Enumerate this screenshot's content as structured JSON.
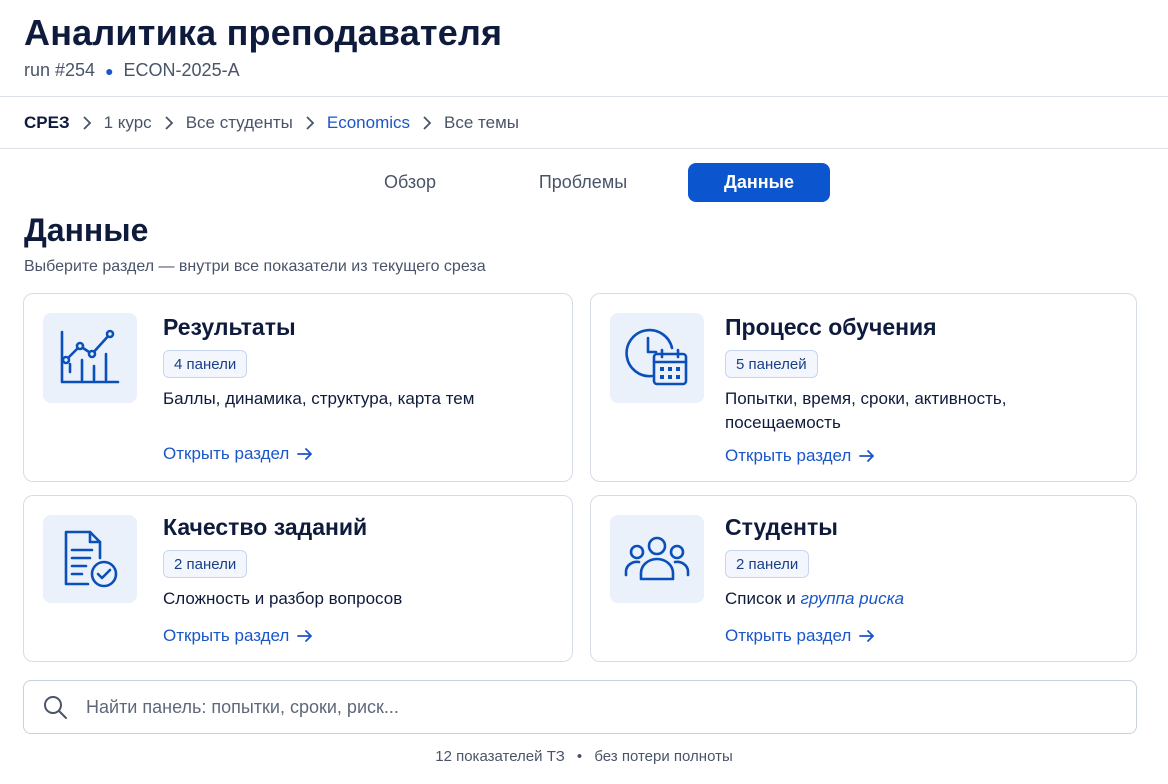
{
  "header": {
    "title": "Аналитика преподавателя",
    "run": "run #254",
    "group": "ECON-2025-A"
  },
  "breadcrumb": {
    "root": "СРЕЗ",
    "items": [
      "1 курс",
      "Все студенты",
      "Economics",
      "Все темы"
    ]
  },
  "tabs": [
    "Обзор",
    "Проблемы",
    "Данные"
  ],
  "active_tab": "Данные",
  "section": {
    "title": "Данные",
    "subtitle": "Выберите раздел — внутри все показатели из текущего среза"
  },
  "cards": [
    {
      "title": "Результаты",
      "badge": "4 панели",
      "desc": "Баллы, динамика, структура, карта тем",
      "link": "Открыть раздел",
      "icon": "chart-icon"
    },
    {
      "title": "Процесс обучения",
      "badge": "5 панелей",
      "desc_line1": "Попытки, время, сроки, активность,",
      "desc_line2": "посещаемость",
      "link": "Открыть раздел",
      "icon": "clock-calendar-icon"
    },
    {
      "title": "Качество заданий",
      "badge": "2 панели",
      "desc": "Сложность и разбор вопросов",
      "link": "Открыть раздел",
      "icon": "document-check-icon"
    },
    {
      "title": "Студенты",
      "badge": "2 панели",
      "desc_prefix": "Список и",
      "desc_link": "группа риска",
      "link": "Открыть раздел",
      "icon": "users-icon"
    }
  ],
  "search": {
    "placeholder": "Найти панель: попытки, сроки, риск..."
  },
  "footer": {
    "left": "12 показателей ТЗ",
    "right": "без потери полноты"
  },
  "colors": {
    "accent": "#0b55cf",
    "link": "#1a56c9",
    "text": "#0f1b3d",
    "icon_bg": "#eaf1fb"
  }
}
